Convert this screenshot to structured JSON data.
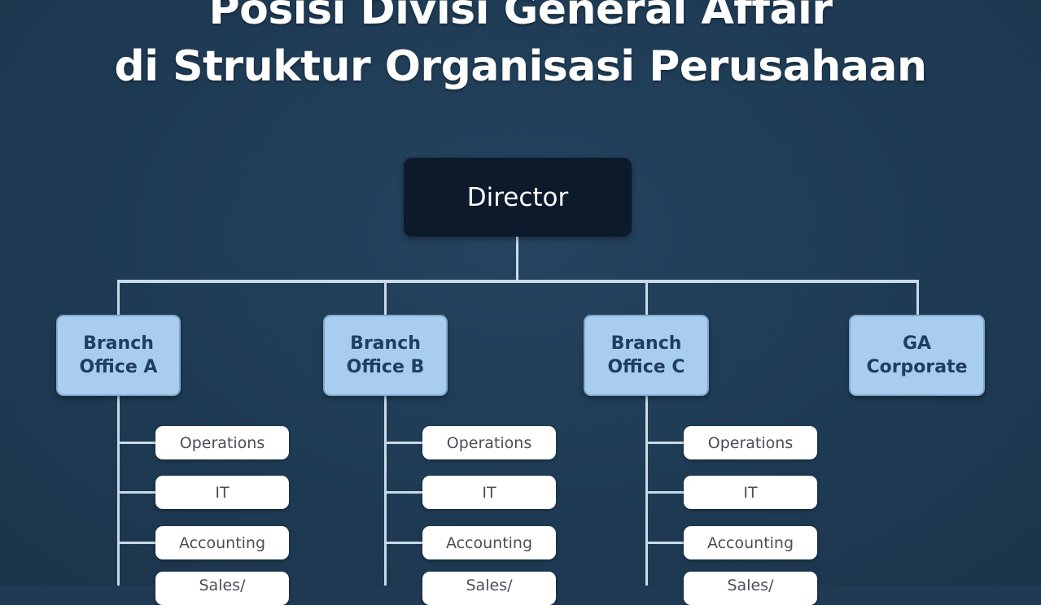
{
  "title": {
    "line1": "Posisi Divisi General Affair",
    "line2": "di Struktur Organisasi Perusahaan"
  },
  "colors": {
    "background": "#1f3a52",
    "director_box": "#0d1a2b",
    "branch_box": "#a9cdee",
    "branch_text": "#1f3e60",
    "dept_box": "#ffffff",
    "connector": "#c8d9e8"
  },
  "chart": {
    "root": "Director",
    "branches": [
      {
        "line1": "Branch",
        "line2": "Office A",
        "departments": [
          "Operations",
          "IT",
          "Accounting",
          "Sales/"
        ]
      },
      {
        "line1": "Branch",
        "line2": "Office B",
        "departments": [
          "Operations",
          "IT",
          "Accounting",
          "Sales/"
        ]
      },
      {
        "line1": "Branch",
        "line2": "Office C",
        "departments": [
          "Operations",
          "IT",
          "Accounting",
          "Sales/"
        ]
      },
      {
        "line1": "GA",
        "line2": "Corporate",
        "departments": []
      }
    ]
  }
}
